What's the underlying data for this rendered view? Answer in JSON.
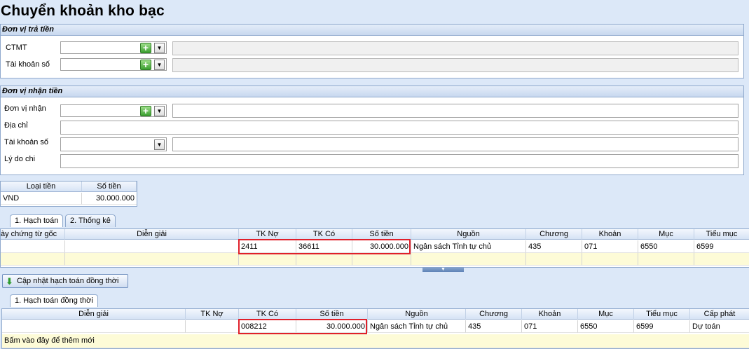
{
  "page_title": "Chuyển khoản kho bạc",
  "payer": {
    "section_title": "Đơn vị trả tiền",
    "ctmt_label": "CTMT",
    "account_label": "Tài khoản số"
  },
  "payee": {
    "section_title": "Đơn vị nhận tiền",
    "unit_label": "Đơn vị nhận",
    "address_label": "Địa chỉ",
    "account_label": "Tài khoản số",
    "reason_label": "Lý do chi"
  },
  "currency_table": {
    "headers": [
      "Loại tiền",
      "Số tiền"
    ],
    "row": [
      "VND",
      "30.000.000"
    ]
  },
  "tabs_top": [
    {
      "label": "1. Hạch toán",
      "active": true
    },
    {
      "label": "2. Thống kê",
      "active": false
    }
  ],
  "grid_top": {
    "headers": [
      "ày chứng từ gốc",
      "Diễn giải",
      "TK Nợ",
      "TK Có",
      "Số tiền",
      "Nguồn",
      "Chương",
      "Khoản",
      "Mục",
      "Tiểu mục"
    ],
    "row": [
      "",
      "",
      "2411",
      "36611",
      "30.000.000",
      "Ngân sách Tỉnh tự chủ",
      "435",
      "071",
      "6550",
      "6599"
    ]
  },
  "update_button_label": "Cập nhật hạch toán đồng thời",
  "tab_bottom_label": "1. Hạch toán đồng thời",
  "grid_bottom": {
    "headers": [
      "Diễn giải",
      "TK Nợ",
      "TK Có",
      "Số tiền",
      "Nguồn",
      "Chương",
      "Khoản",
      "Mục",
      "Tiểu mục",
      "Cấp phát"
    ],
    "row": [
      "",
      "",
      "008212",
      "30.000.000",
      "Ngân sách Tỉnh tự chủ",
      "435",
      "071",
      "6550",
      "6599",
      "Dự toán"
    ],
    "add_new_text": "Bấm vào đây để thêm mới"
  },
  "icons": {
    "add": "add-plus-icon",
    "dropdown": "chevron-down-icon",
    "update": "green-down-arrow-icon",
    "splitter": "collapse-arrow-icon"
  },
  "colors": {
    "highlight": "#e0202a",
    "row_highlight": "#fdfbd7",
    "background": "#dce8f8"
  }
}
